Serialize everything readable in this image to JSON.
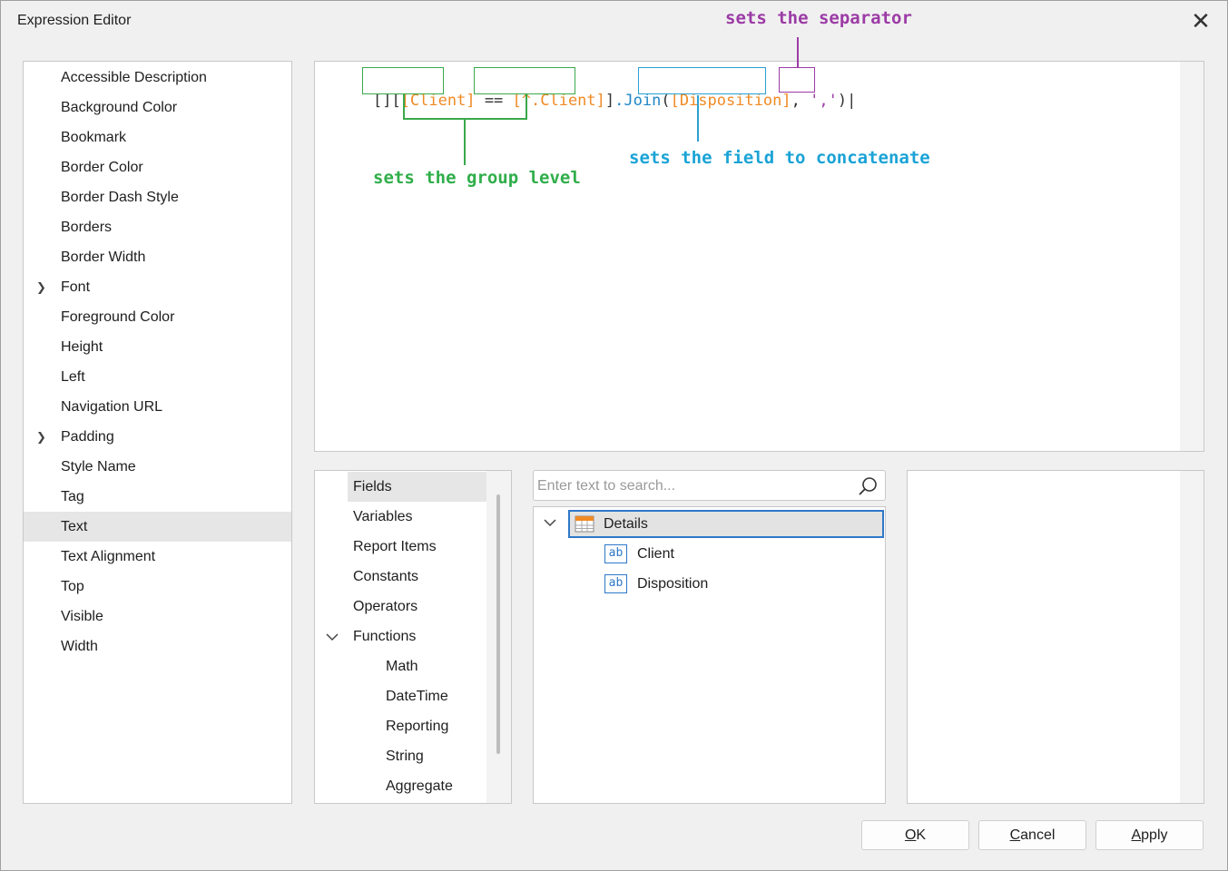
{
  "window": {
    "title": "Expression Editor",
    "close_glyph": "✕"
  },
  "properties": [
    {
      "label": "Accessible Description",
      "expandable": false,
      "selected": false
    },
    {
      "label": "Background Color",
      "expandable": false,
      "selected": false
    },
    {
      "label": "Bookmark",
      "expandable": false,
      "selected": false
    },
    {
      "label": "Border Color",
      "expandable": false,
      "selected": false
    },
    {
      "label": "Border Dash Style",
      "expandable": false,
      "selected": false
    },
    {
      "label": "Borders",
      "expandable": false,
      "selected": false
    },
    {
      "label": "Border Width",
      "expandable": false,
      "selected": false
    },
    {
      "label": "Font",
      "expandable": true,
      "selected": false
    },
    {
      "label": "Foreground Color",
      "expandable": false,
      "selected": false
    },
    {
      "label": "Height",
      "expandable": false,
      "selected": false
    },
    {
      "label": "Left",
      "expandable": false,
      "selected": false
    },
    {
      "label": "Navigation URL",
      "expandable": false,
      "selected": false
    },
    {
      "label": "Padding",
      "expandable": true,
      "selected": false
    },
    {
      "label": "Style Name",
      "expandable": false,
      "selected": false
    },
    {
      "label": "Tag",
      "expandable": false,
      "selected": false
    },
    {
      "label": "Text",
      "expandable": false,
      "selected": true
    },
    {
      "label": "Text Alignment",
      "expandable": false,
      "selected": false
    },
    {
      "label": "Top",
      "expandable": false,
      "selected": false
    },
    {
      "label": "Visible",
      "expandable": false,
      "selected": false
    },
    {
      "label": "Width",
      "expandable": false,
      "selected": false
    }
  ],
  "expression": {
    "prefix": "[]",
    "open_bracket": "[",
    "field1": "[Client]",
    "operator": " == ",
    "field2": "[^.Client]",
    "close_bracket": "]",
    "join": ".Join",
    "open_paren": "(",
    "field3": "[Disposition]",
    "comma": ",",
    "separator": "','",
    "close_paren": ")"
  },
  "annotations": {
    "separator_note": "sets the separator",
    "group_note": "sets the group level",
    "field_note": "sets the field to concatenate"
  },
  "categories": {
    "items": [
      {
        "label": "Fields",
        "level": 0,
        "selected": true
      },
      {
        "label": "Variables",
        "level": 0,
        "selected": false
      },
      {
        "label": "Report Items",
        "level": 0,
        "selected": false
      },
      {
        "label": "Constants",
        "level": 0,
        "selected": false
      },
      {
        "label": "Operators",
        "level": 0,
        "selected": false
      },
      {
        "label": "Functions",
        "level": 0,
        "selected": false,
        "expanded": true
      },
      {
        "label": "Math",
        "level": 1,
        "selected": false
      },
      {
        "label": "DateTime",
        "level": 1,
        "selected": false
      },
      {
        "label": "Reporting",
        "level": 1,
        "selected": false
      },
      {
        "label": "String",
        "level": 1,
        "selected": false
      },
      {
        "label": "Aggregate",
        "level": 1,
        "selected": false
      }
    ]
  },
  "search": {
    "placeholder": "Enter text to search...",
    "value": ""
  },
  "tree": {
    "root_label": "Details",
    "root_icon": "table-icon",
    "children": [
      {
        "label": "Client",
        "icon": "string-field-icon",
        "icon_text": "ab"
      },
      {
        "label": "Disposition",
        "icon": "string-field-icon",
        "icon_text": "ab"
      }
    ]
  },
  "buttons": {
    "ok": {
      "mnemonic": "O",
      "rest": "K"
    },
    "cancel": {
      "mnemonic": "C",
      "rest": "ancel"
    },
    "apply": {
      "mnemonic": "A",
      "rest": "pply"
    }
  },
  "colors": {
    "field": "#f08a24",
    "function": "#1f86c8",
    "separator": "#9c3ba6",
    "group_note": "#2fae4a",
    "field_note": "#1aa3d6",
    "selection_border": "#2d78c8"
  }
}
